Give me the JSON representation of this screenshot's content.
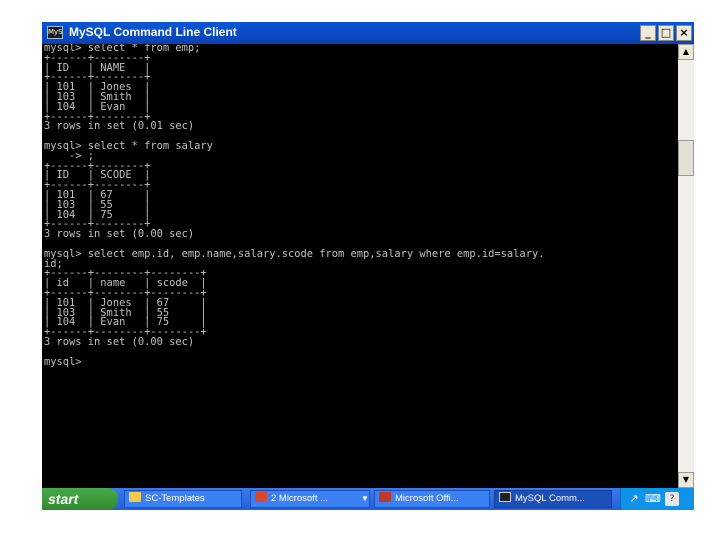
{
  "window": {
    "title": "MySQL Command Line Client",
    "icon_label": "MyS",
    "controls": {
      "minimize": "_",
      "maximize": "□",
      "close": "×"
    }
  },
  "console_lines": [
    "mysql> select * from emp;",
    "+------+--------+",
    "| ID   | NAME   |",
    "+------+--------+",
    "| 101  | Jones  |",
    "| 103  | Smith  |",
    "| 104  | Evan   |",
    "+------+--------+",
    "3 rows in set (0.01 sec)",
    "",
    "mysql> select * from salary",
    "    -> ;",
    "+------+--------+",
    "| ID   | SCODE  |",
    "+------+--------+",
    "| 101  | 67     |",
    "| 103  | 55     |",
    "| 104  | 75     |",
    "+------+--------+",
    "3 rows in set (0.00 sec)",
    "",
    "mysql> select emp.id, emp.name,salary.scode from emp,salary where emp.id=salary.",
    "id;",
    "+------+--------+--------+",
    "| id   | name   | scode  |",
    "+------+--------+--------+",
    "| 101  | Jones  | 67     |",
    "| 103  | Smith  | 55     |",
    "| 104  | Evan   | 75     |",
    "+------+--------+--------+",
    "3 rows in set (0.00 sec)",
    "",
    "mysql>"
  ],
  "scrollbar": {
    "up_arrow": "▲",
    "down_arrow": "▼"
  },
  "taskbar": {
    "start_label": "start",
    "tasks": [
      {
        "label": "SC-Templates"
      },
      {
        "label": "2 Microsoft ...",
        "caret": "▼"
      },
      {
        "label": "Microsoft Offi..."
      },
      {
        "label": "MySQL Comm..."
      }
    ],
    "tray": {
      "icon1": "↗",
      "icon2": "⌨",
      "icon3": "?"
    }
  }
}
